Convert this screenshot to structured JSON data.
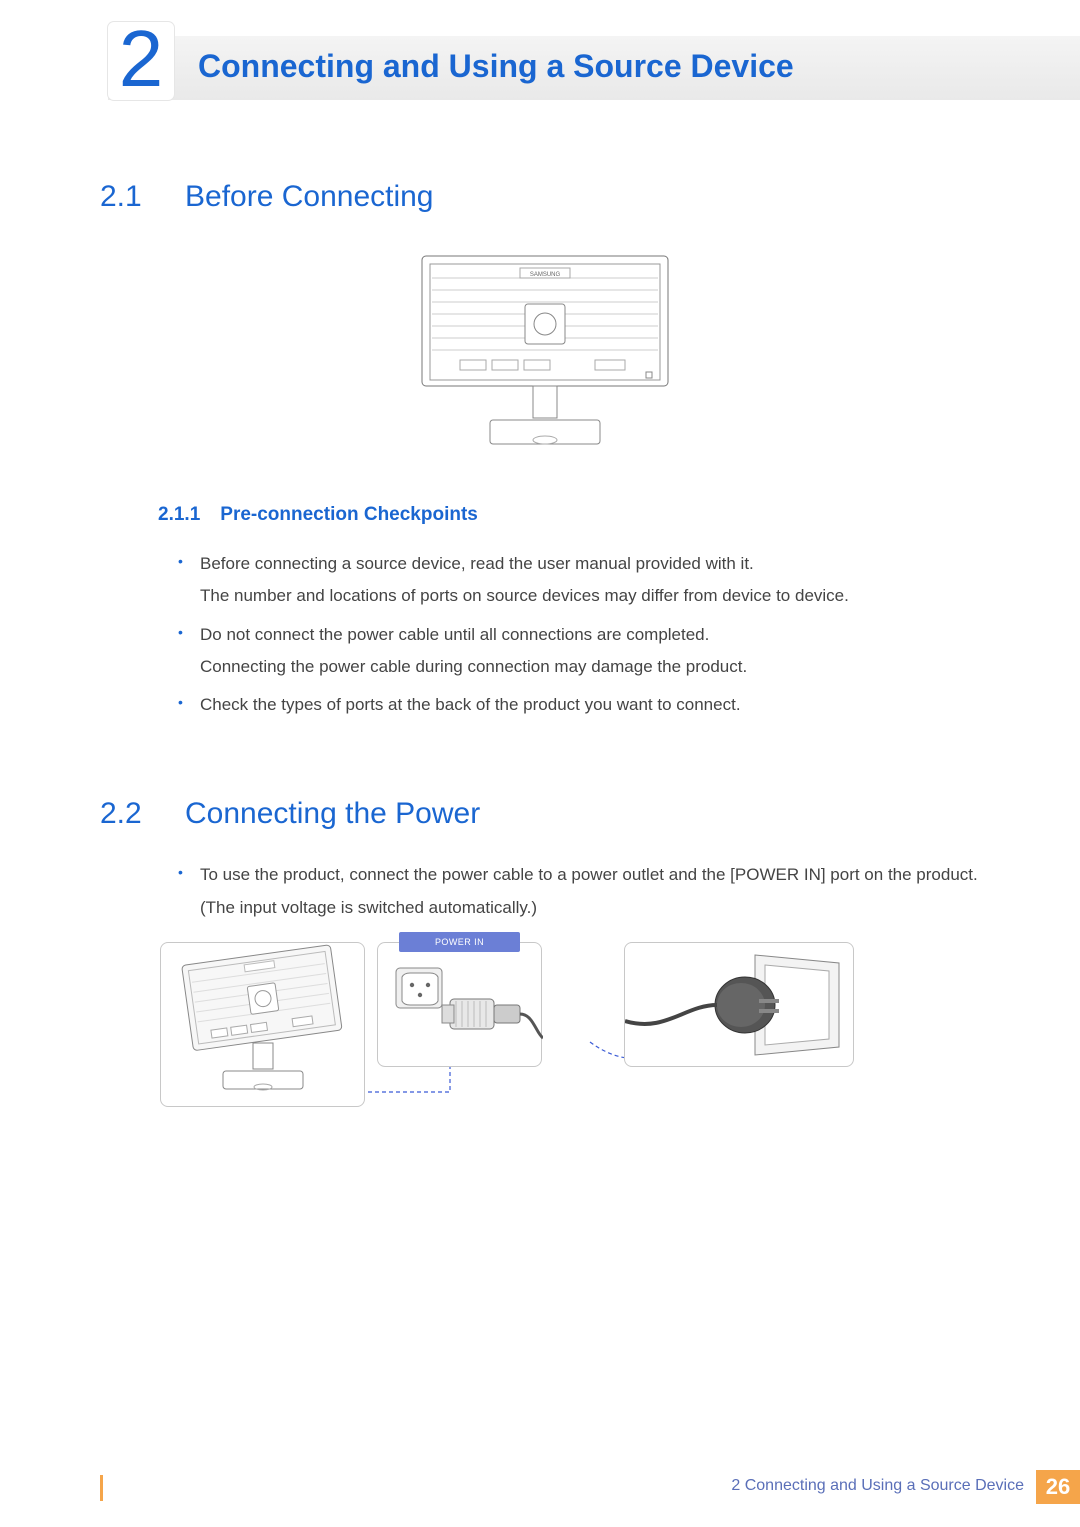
{
  "chapter": {
    "number": "2",
    "title": "Connecting and Using a Source Device"
  },
  "sections": {
    "s1": {
      "num": "2.1",
      "title": "Before Connecting",
      "sub1": {
        "num": "2.1.1",
        "title": "Pre-connection Checkpoints"
      },
      "bullets": {
        "b1a": "Before connecting a source device, read the user manual provided with it.",
        "b1b": "The number and locations of ports on source devices may differ from device to device.",
        "b2a": "Do not connect the power cable until all connections are completed.",
        "b2b": "Connecting the power cable during connection may damage the product.",
        "b3": "Check the types of ports at the back of the product you want to connect."
      }
    },
    "s2": {
      "num": "2.2",
      "title": "Connecting the Power",
      "bullets": {
        "b1": "To use the product, connect the power cable to a power outlet and the [POWER IN] port on the product.(The input voltage is switched automatically.)"
      }
    }
  },
  "labels": {
    "monitor_brand": "SAMSUNG",
    "power_in": "POWER IN"
  },
  "footer": {
    "text": "2 Connecting and Using a Source Device",
    "page": "26"
  }
}
